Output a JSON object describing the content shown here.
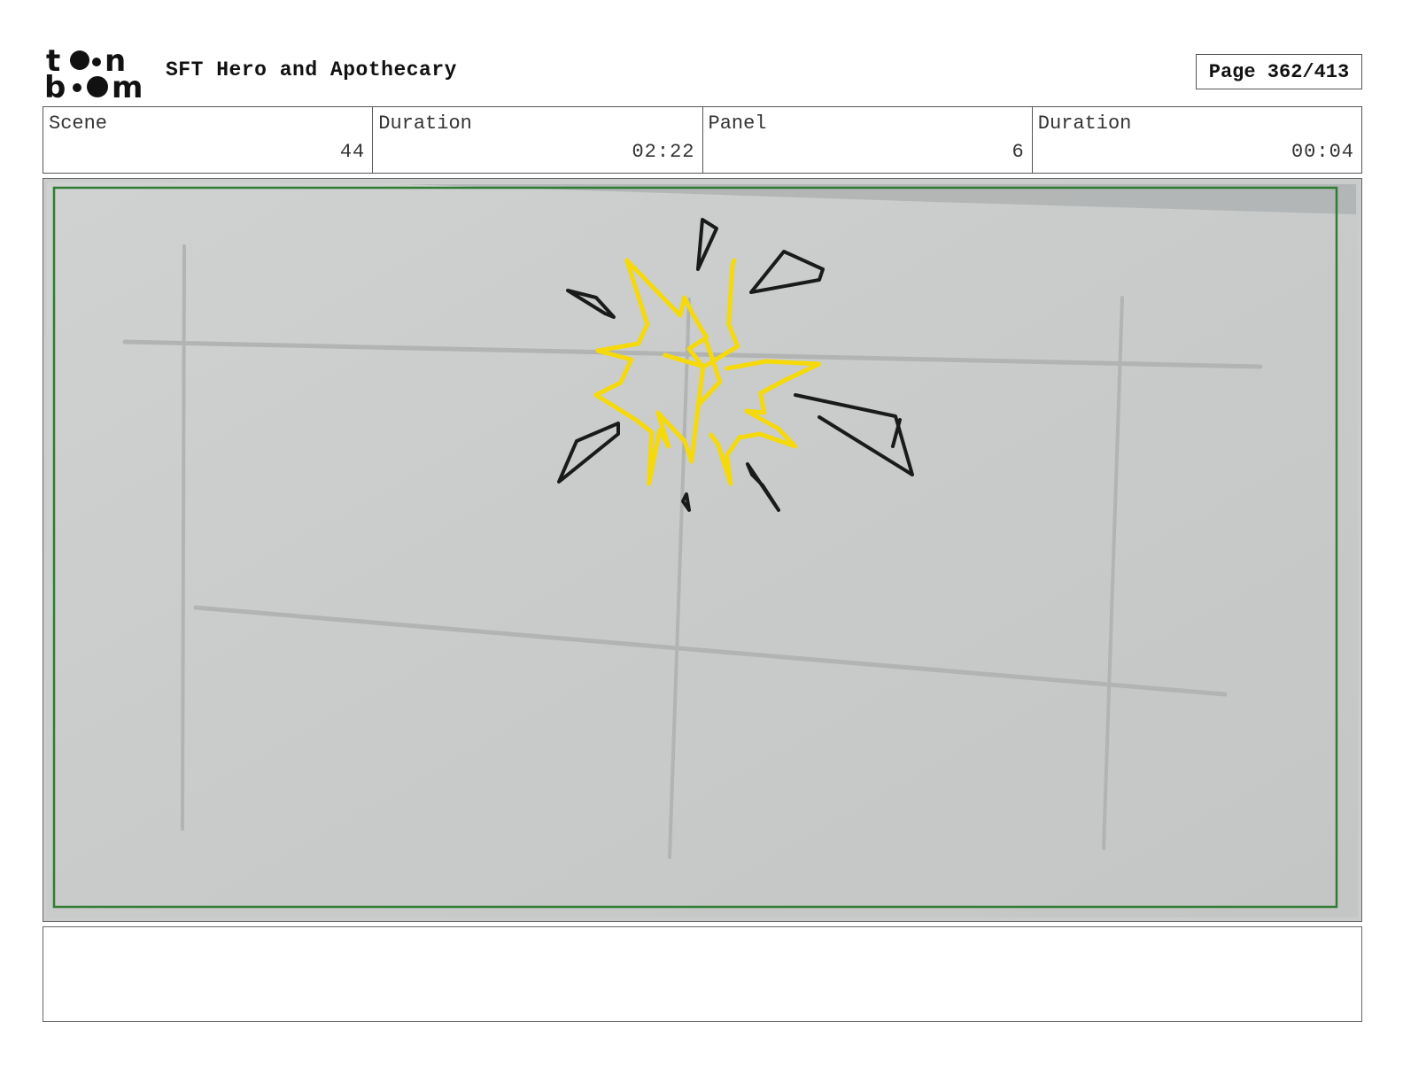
{
  "header": {
    "logo_text": "toon boom",
    "project_title": "SFT Hero and Apothecary",
    "page_label": "Page 362/413"
  },
  "info": {
    "scene_label": "Scene",
    "scene_value": "44",
    "scene_duration_label": "Duration",
    "scene_duration_value": "02:22",
    "panel_label": "Panel",
    "panel_value": "6",
    "panel_duration_label": "Duration",
    "panel_duration_value": "00:04"
  },
  "panel": {
    "background_color": "#cbcdcd",
    "safe_frame_color": "#2e7d32",
    "burst_color": "#f5d90a",
    "debris_color": "#1a1a1a"
  },
  "notes": {
    "text": ""
  }
}
